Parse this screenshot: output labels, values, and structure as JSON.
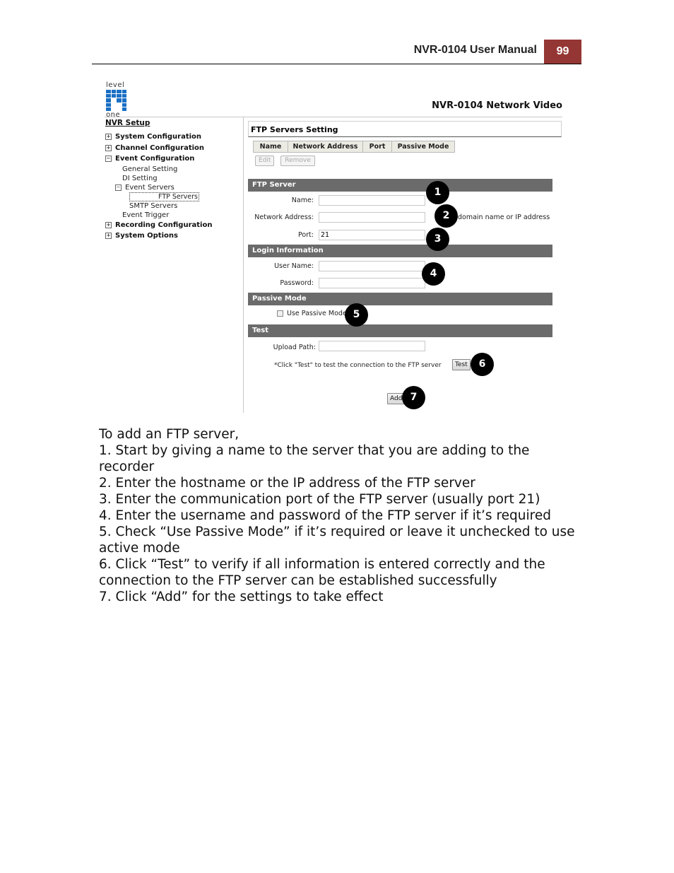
{
  "header": {
    "manual_title": "NVR-0104 User Manual",
    "page_number": "99",
    "page_badge_color": "#943634"
  },
  "app": {
    "logo_top": "level",
    "logo_bottom": "one",
    "title": "NVR-0104 Network Video"
  },
  "sidebar": {
    "heading": "NVR Setup",
    "items": [
      {
        "label": "System Configuration",
        "toggle": "+"
      },
      {
        "label": "Channel Configuration",
        "toggle": "+"
      },
      {
        "label": "Event Configuration",
        "toggle": "−"
      },
      {
        "label": "General Setting"
      },
      {
        "label": "DI Setting"
      },
      {
        "label": "Event Servers",
        "toggle": "−"
      },
      {
        "label": "FTP Servers",
        "selected": true
      },
      {
        "label": "SMTP Servers"
      },
      {
        "label": "Event Trigger"
      },
      {
        "label": "Recording Configuration",
        "toggle": "+"
      },
      {
        "label": "System Options",
        "toggle": "+"
      }
    ]
  },
  "main": {
    "panel_title": "FTP Servers Setting",
    "table_columns": [
      "Name",
      "Network Address",
      "Port",
      "Passive Mode"
    ],
    "edit_button": "Edit",
    "remove_button": "Remove",
    "sections": {
      "ftp_server": "FTP Server",
      "login": "Login Information",
      "passive": "Passive Mode",
      "test": "Test"
    },
    "fields": {
      "name_label": "Name:",
      "name_value": "",
      "address_label": "Network Address:",
      "address_value": "",
      "address_hint": "domain name or IP address",
      "port_label": "Port:",
      "port_value": "21",
      "user_label": "User Name:",
      "user_value": "",
      "password_label": "Password:",
      "password_value": "",
      "passive_label": "Use Passive Mode",
      "passive_checked": false,
      "upload_label": "Upload Path:",
      "upload_value": ""
    },
    "test_hint": "*Click \"Test\" to test the connection to the FTP server",
    "test_button": "Test",
    "add_button": "Add",
    "callouts": [
      "1",
      "2",
      "3",
      "4",
      "5",
      "6",
      "7"
    ]
  },
  "body": {
    "intro": "To add an FTP server,",
    "steps": [
      "1. Start by giving a name to the server that you are adding to the recorder",
      "2. Enter the hostname or the IP address of the FTP server",
      "3. Enter the communication port of the FTP server (usually port 21)",
      "4. Enter the username and password of the FTP server if it’s required",
      "5. Check “Use Passive Mode” if it’s required or leave it unchecked to use active mode",
      "6. Click “Test” to verify if all information is entered correctly and the connection to the FTP server can be established successfully",
      "7. Click “Add” for the settings to take effect"
    ]
  }
}
